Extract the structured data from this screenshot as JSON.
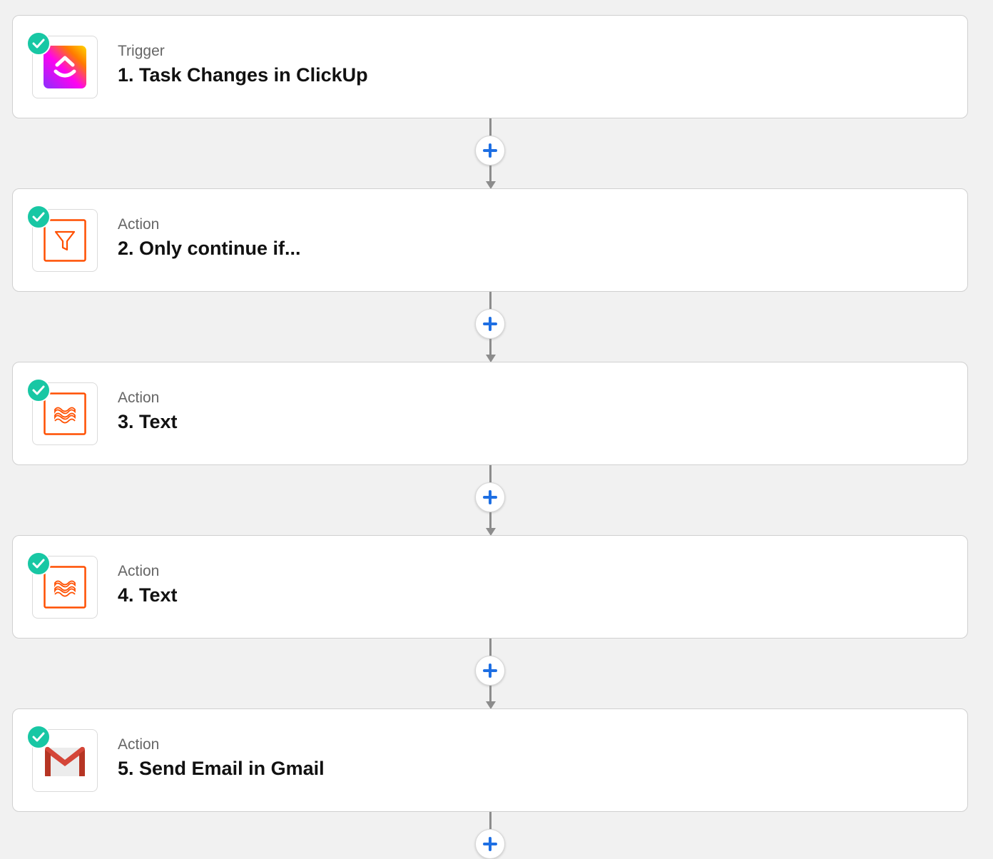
{
  "colors": {
    "background": "#f1f1f1",
    "card": "#ffffff",
    "success_check": "#18c7a4",
    "add_button_plus": "#1e6fe3",
    "connector": "#8c8c8c",
    "zapier_orange": "#ff4f00",
    "gmail_red": "#d44638"
  },
  "steps": [
    {
      "type": "Trigger",
      "title": "1. Task Changes in ClickUp",
      "app_icon": "clickup-logo-icon",
      "status_icon": "check-icon"
    },
    {
      "type": "Action",
      "title": "2. Only continue if...",
      "app_icon": "filter-icon",
      "status_icon": "check-icon"
    },
    {
      "type": "Action",
      "title": "3. Text",
      "app_icon": "formatter-text-icon",
      "status_icon": "check-icon"
    },
    {
      "type": "Action",
      "title": "4. Text",
      "app_icon": "formatter-text-icon",
      "status_icon": "check-icon"
    },
    {
      "type": "Action",
      "title": "5. Send Email in Gmail",
      "app_icon": "gmail-logo-icon",
      "status_icon": "check-icon"
    }
  ],
  "add_step": {
    "icon": "plus-icon"
  }
}
